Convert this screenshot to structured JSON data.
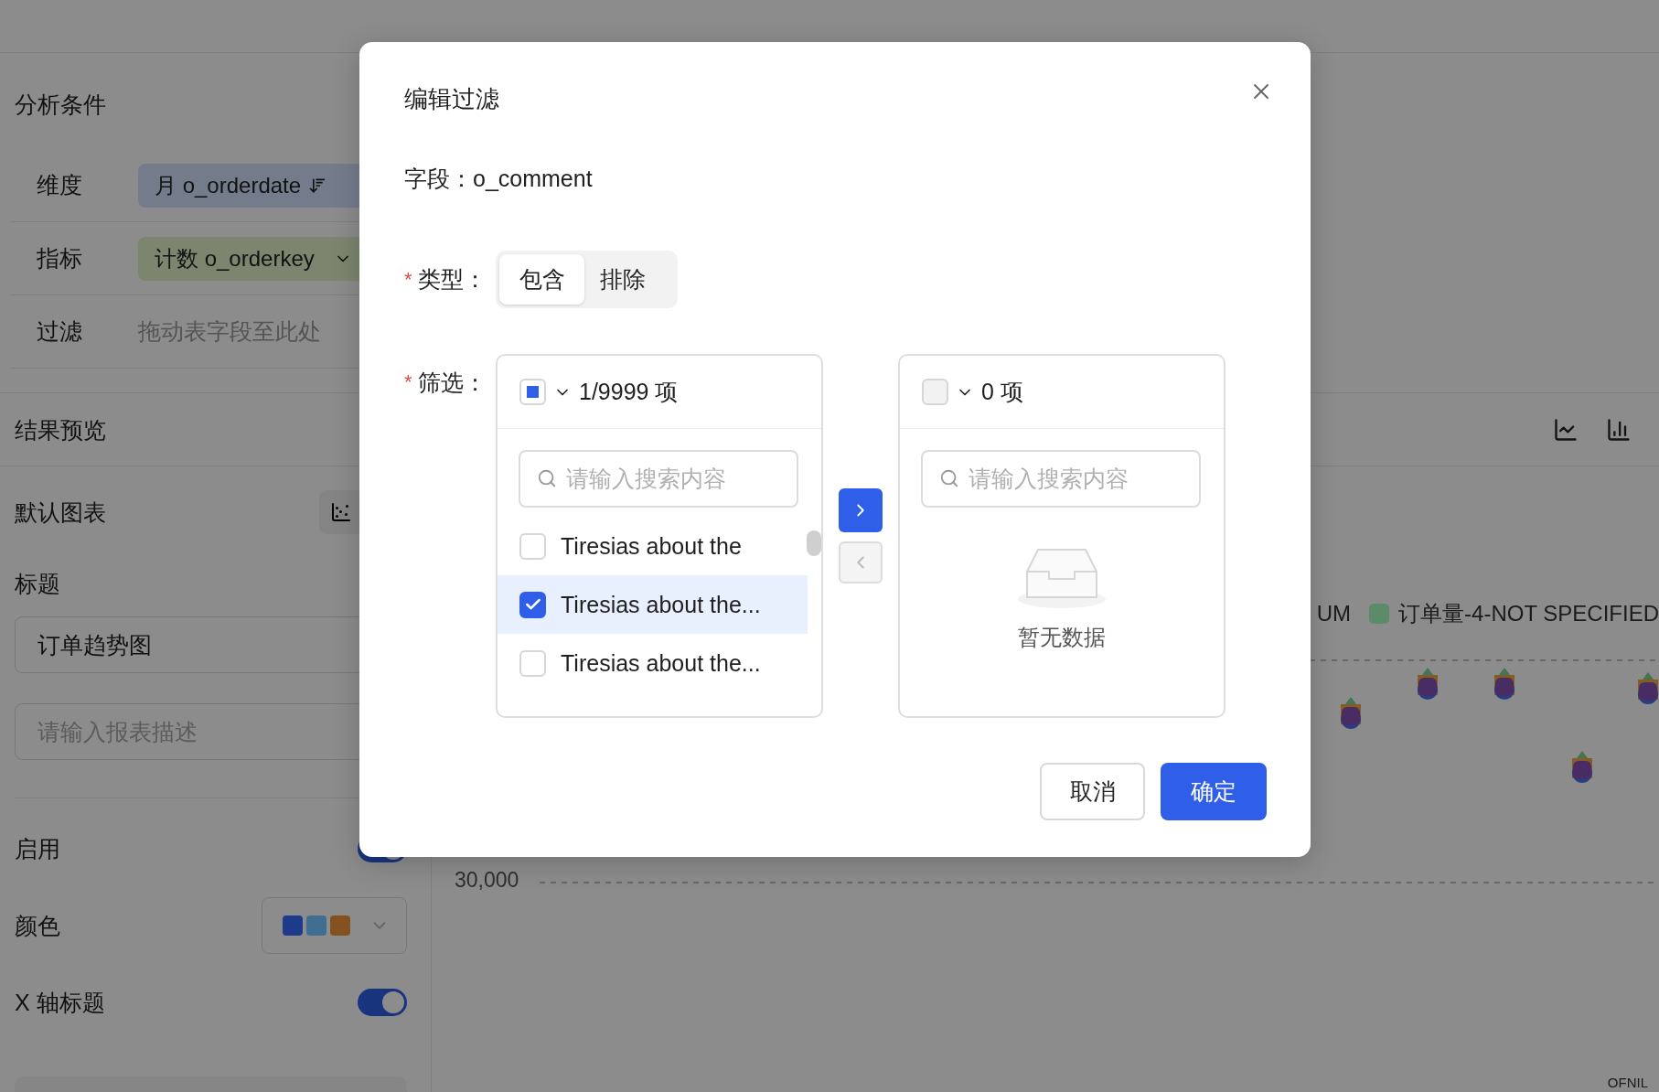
{
  "sidebar": {
    "conditions_title": "分析条件",
    "conditions": [
      {
        "kind": "dimension",
        "label": "维度",
        "value": "月 o_orderdate"
      },
      {
        "kind": "measure",
        "label": "指标",
        "value": "计数 o_orderkey"
      },
      {
        "kind": "drop",
        "label": "过滤",
        "hint": "拖动表字段至此处"
      }
    ],
    "preview_title": "结果预览",
    "default_chart_label": "默认图表",
    "title_label": "标题",
    "title_value": "订单趋势图",
    "description_placeholder": "请输入报表描述",
    "settings": [
      {
        "kind": "toggle",
        "label": "启用",
        "on": true
      },
      {
        "kind": "colors",
        "label": "颜色",
        "swatches": [
          {
            "color": "#1e3a8a"
          },
          {
            "color": "#3f6e92"
          },
          {
            "color": "#84521e"
          }
        ]
      },
      {
        "kind": "toggle",
        "label": "X 轴标题",
        "on": true
      }
    ]
  },
  "chart": {
    "legend": [
      {
        "label": "UM"
      },
      {
        "label": "订单量-4-NOT SPECIFIED",
        "color": "#5b8b68"
      }
    ],
    "axis_label": "30,000",
    "footer_mark": "OFNIL"
  },
  "dialog": {
    "title": "编辑过滤",
    "field": "字段：o_comment",
    "type_row": {
      "required_mark": "*",
      "label": "类型：",
      "options": [
        {
          "label": "包含",
          "selected": true
        },
        {
          "label": "排除",
          "selected": false
        }
      ]
    },
    "filter_row": {
      "required_mark": "*",
      "label": "筛选："
    },
    "source": {
      "count": "1/9999 项",
      "indeterminate": true,
      "disabled": false,
      "search_placeholder": "请输入搜索内容",
      "items": [
        {
          "label": "Tiresias about the",
          "checked": false,
          "selected": false
        },
        {
          "label": "Tiresias about the...",
          "checked": true,
          "selected": true
        },
        {
          "label": "Tiresias about the...",
          "checked": false,
          "selected": false
        }
      ]
    },
    "move_buttons": [
      {
        "kind": "right",
        "disabled": false
      },
      {
        "kind": "left",
        "disabled": true
      }
    ],
    "target": {
      "count": "0 项",
      "indeterminate": false,
      "disabled": true,
      "search_placeholder": "请输入搜索内容",
      "empty_text": "暂无数据"
    },
    "buttons": [
      {
        "kind": "secondary",
        "label": "取消"
      },
      {
        "kind": "primary",
        "label": "确定"
      }
    ]
  }
}
